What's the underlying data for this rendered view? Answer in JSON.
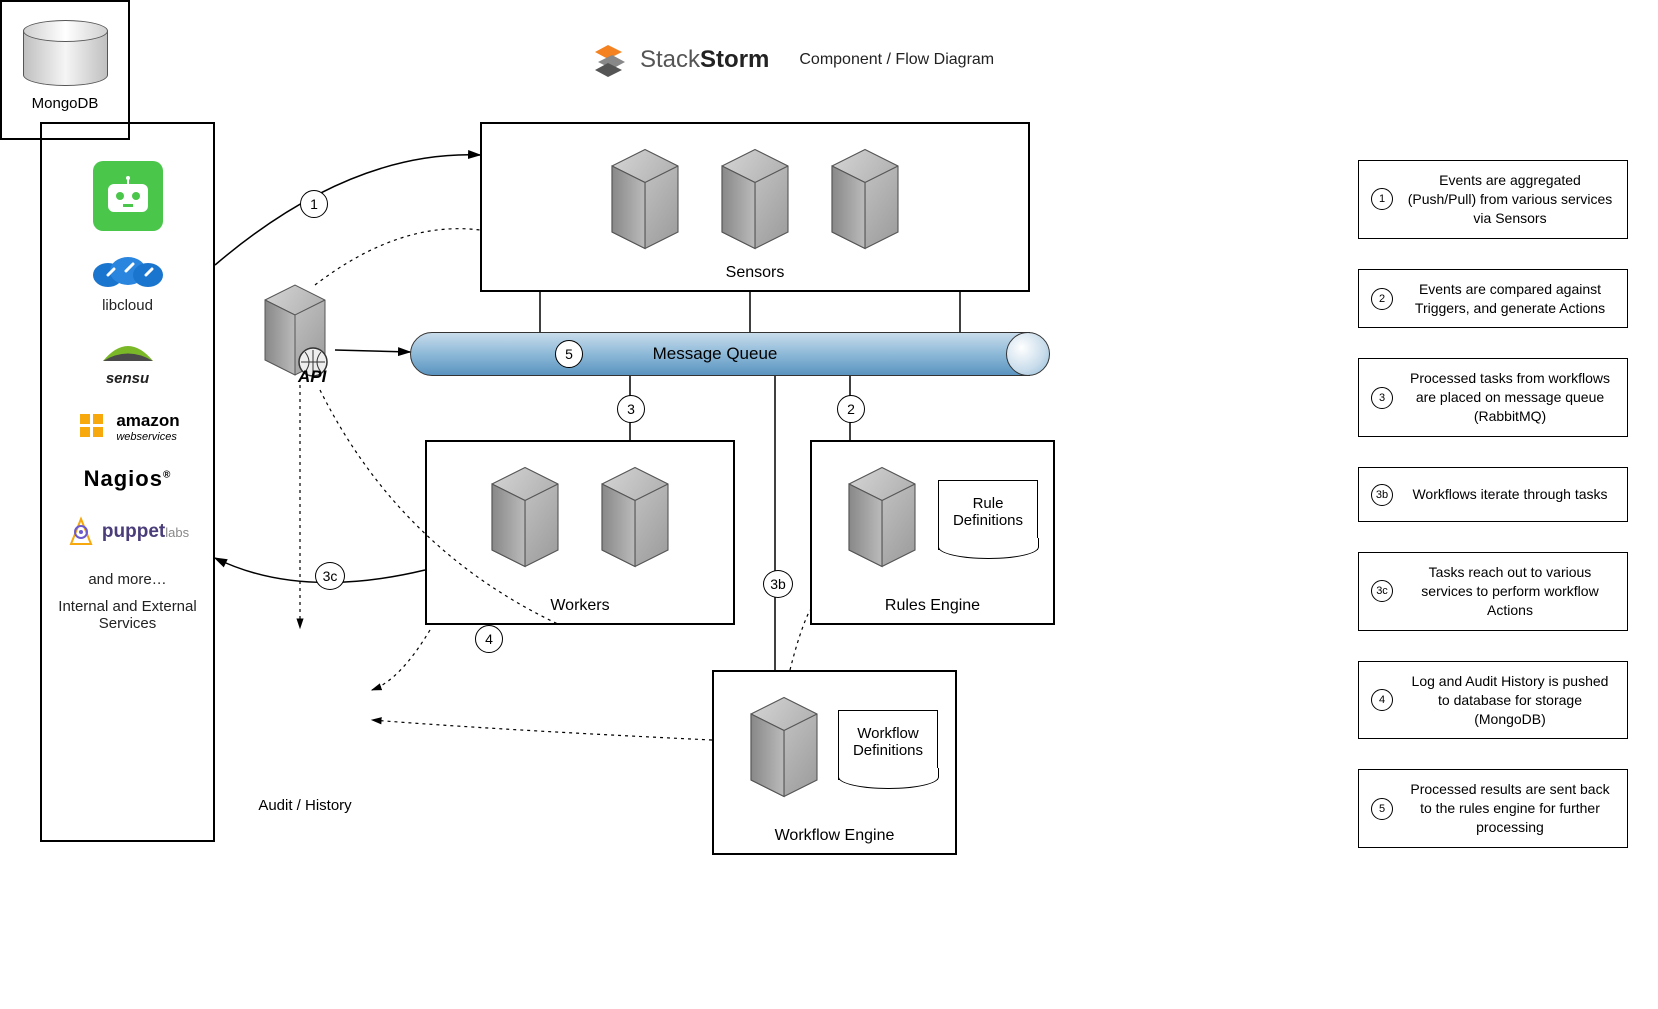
{
  "header": {
    "brand_part1": "Stack",
    "brand_part2": "Storm",
    "subtitle": "Component / Flow Diagram"
  },
  "services": {
    "items": [
      {
        "id": "robot",
        "label": ""
      },
      {
        "id": "libcloud",
        "label": "libcloud"
      },
      {
        "id": "sensu",
        "label": "sensu"
      },
      {
        "id": "aws",
        "label": "amazon",
        "sublabel": "webservices"
      },
      {
        "id": "nagios",
        "label": "Nagios"
      },
      {
        "id": "puppet",
        "label": "puppet",
        "sublabel": "labs"
      }
    ],
    "more": "and more…",
    "caption": "Internal and External Services"
  },
  "api": {
    "label": "API"
  },
  "components": {
    "sensors": "Sensors",
    "message_queue": "Message Queue",
    "workers": "Workers",
    "rules_engine": "Rules Engine",
    "rule_definitions": "Rule Definitions",
    "workflow_engine": "Workflow Engine",
    "workflow_definitions": "Workflow Definitions",
    "mongodb": "MongoDB",
    "audit_history": "Audit / History"
  },
  "steps": {
    "s1": "1",
    "s2": "2",
    "s3": "3",
    "s3b": "3b",
    "s3c": "3c",
    "s4": "4",
    "s5": "5"
  },
  "legend": [
    {
      "num": "1",
      "text": "Events are aggregated (Push/Pull) from various services via Sensors"
    },
    {
      "num": "2",
      "text": "Events are compared against Triggers, and generate Actions"
    },
    {
      "num": "3",
      "text": "Processed tasks from workflows are placed on message queue (RabbitMQ)"
    },
    {
      "num": "3b",
      "text": "Workflows iterate through tasks"
    },
    {
      "num": "3c",
      "text": "Tasks reach out to various services to perform workflow Actions"
    },
    {
      "num": "4",
      "text": "Log and Audit History is pushed to database for storage (MongoDB)"
    },
    {
      "num": "5",
      "text": "Processed results are sent back to the rules engine for further processing"
    }
  ]
}
